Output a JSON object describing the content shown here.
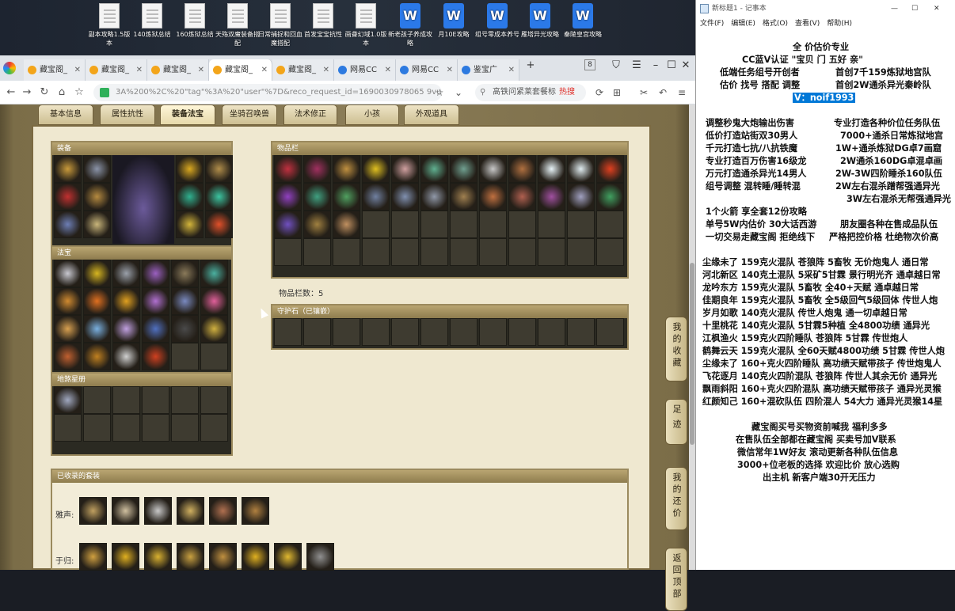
{
  "desktop": {
    "icons": [
      {
        "label": "副本攻略1.5版本",
        "kind": "doc"
      },
      {
        "label": "140炼狱总结",
        "kind": "doc"
      },
      {
        "label": "160炼狱总结",
        "kind": "doc"
      },
      {
        "label": "天殇双魔装备搭配",
        "kind": "doc"
      },
      {
        "label": "日常捕捉和回血魔搭配",
        "kind": "doc"
      },
      {
        "label": "首发宝宝抗性",
        "kind": "doc"
      },
      {
        "label": "画聋幻域1.0版本",
        "kind": "doc"
      },
      {
        "label": "新老孩子养成攻略",
        "kind": "wps"
      },
      {
        "label": "月10E攻略",
        "kind": "wps"
      },
      {
        "label": "组号零成本养号",
        "kind": "wps"
      },
      {
        "label": "雁塔异光攻略",
        "kind": "wps"
      },
      {
        "label": "秦陵皇宫攻略",
        "kind": "wps"
      }
    ]
  },
  "browser": {
    "tabs": [
      {
        "label": "藏宝阁_",
        "active": false,
        "fav": "orange"
      },
      {
        "label": "藏宝阁_",
        "active": false,
        "fav": "orange"
      },
      {
        "label": "藏宝阁_",
        "active": false,
        "fav": "orange"
      },
      {
        "label": "藏宝阁_",
        "active": true,
        "fav": "orange"
      },
      {
        "label": "藏宝阁_",
        "active": false,
        "fav": "orange"
      },
      {
        "label": "网易CC",
        "active": false,
        "fav": "blue"
      },
      {
        "label": "网易CC",
        "active": false,
        "fav": "blue"
      },
      {
        "label": "鉴宝广",
        "active": false,
        "fav": "blue"
      }
    ],
    "tab_count": "8",
    "url": "3A%200%2C%20\"tag\"%3A%20\"user\"%7D&reco_request_id=1690030978065 9vu86",
    "search_text": "高铁问紧莱套餐标",
    "hot_label": "热搜"
  },
  "game": {
    "tabs": [
      "基本信息",
      "属性抗性",
      "装备法宝",
      "坐骑召唤兽",
      "法术修正",
      "小孩",
      "外观道具"
    ],
    "active_tab": "装备法宝",
    "sections": {
      "equip": "装备",
      "fabao": "法宝",
      "dizhang": "地煞星册",
      "items": "物品栏",
      "guard": "守护石（已镶嵌）",
      "sets": "已收录的套装"
    },
    "item_count_label": "物品栏数：5",
    "set_rows": [
      "雅声:",
      "于归:"
    ],
    "side_tabs": [
      "我的收藏",
      "足迹",
      "我的还价",
      "返回顶部"
    ]
  },
  "notepad": {
    "title": "新标题1 - 记事本",
    "menu": [
      "文件(F)",
      "编辑(E)",
      "格式(O)",
      "查看(V)",
      "帮助(H)"
    ],
    "lines": [
      "全 价估价专业",
      "CC蓝V认证 \"宝贝 门 五好 亲\"",
      "低端任务组号开创者",
      "首创7千159炼狱地宫队",
      "估价 找号 搭配 调整",
      "首创2W通杀异光秦岭队",
      "V：noif1993",
      "调整秒鬼大炮输出伤害",
      "专业打造各种价位任务队伍",
      "低价打造站街双30男人",
      "7000+通杀日常炼狱地宫",
      "千元打造七抗/八抗铁魔",
      "1W+通杀炼狱DG卓7画窟",
      "专业打造百万伤害16级龙",
      "2W通杀160DG卓混卓画",
      "万元打造通杀异光14男人",
      "2W-3W四阶睡杀160队伍",
      "组号调整 混转睡/睡转混",
      "2W左右混杀蹭帮强通异光",
      "3W左右混杀无帮强通异光",
      "1个火箭 享全套12份攻略",
      "单号5W内估价 30大话西游",
      "朋友圈各种在售成品队伍",
      "一切交易走藏宝阁 拒绝线下",
      "严格把控价格 杜绝物次价高",
      "尘缘未了 159克火混队 苍狼阵 5畜牧 无价炮鬼人 通日常",
      "河北新区 140克土混队 5采矿5甘霖 景行明光齐 通卓越日常",
      "龙吟东方 159克火混队 5畜牧 全40+天赋 通卓越日常",
      "佳期良年 159克火混队 5畜牧 全5级回气5级回体 传世人炮",
      "岁月如歌 140克火混队 传世人炮鬼 通一切卓越日常",
      "十里桃花 140克火混队 5甘霖5种植 全4800功绩 通异光",
      "江枫渔火 159克火四阶睡队 苍狼阵 5甘霖 传世炮人",
      "鹤舞云天 159克火混队 全60天赋4800功绩 5甘霖 传世人炮",
      "尘缘未了 160+克火四阶睡队 高功绩天赋带孩子 传世炮鬼人",
      "飞花逐月 140克火四阶混队 苍狼阵 传世人其余无价 通异光",
      "飘雨斜阳 160+克火四阶混队 高功绩天赋带孩子 通异光灵猴",
      "红颜知己 160+混砍队伍 四阶混人 54大力 通异光灵猴14星",
      "藏宝阁买号买物资前喊我 福利多多",
      "在售队伍全部都在藏宝阁 买卖号加V联系",
      "微信常年1W好友 滚动更新各种队伍信息",
      "3000+位老板的选择 欢迎比价 放心选购",
      "出主机 新客户端30开无压力"
    ]
  },
  "colors": {
    "panel_bg": "#efe8d0",
    "box_head": "#a8945f",
    "accent_blue": "#0078d7"
  }
}
